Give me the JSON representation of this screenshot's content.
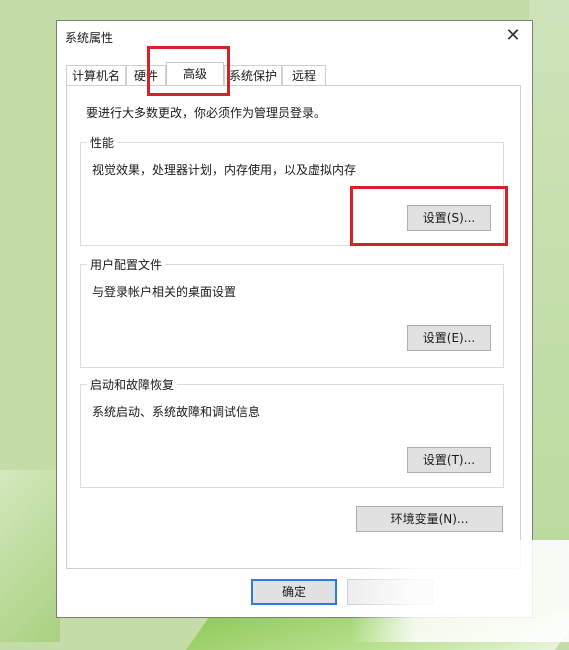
{
  "dialog": {
    "title": "系统属性",
    "close_glyph": "✕"
  },
  "tabs": [
    {
      "label": "计算机名"
    },
    {
      "label": "硬件"
    },
    {
      "label": "高级"
    },
    {
      "label": "系统保护"
    },
    {
      "label": "远程"
    }
  ],
  "active_tab": "高级",
  "advanced": {
    "admin_note": "要进行大多数更改，你必须作为管理员登录。",
    "performance": {
      "title": "性能",
      "desc": "视觉效果，处理器计划，内存使用，以及虚拟内存",
      "button": "设置(S)..."
    },
    "profiles": {
      "title": "用户配置文件",
      "desc": "与登录帐户相关的桌面设置",
      "button": "设置(E)..."
    },
    "startup": {
      "title": "启动和故障恢复",
      "desc": "系统启动、系统故障和调试信息",
      "button": "设置(T)..."
    },
    "env_button": "环境变量(N)..."
  },
  "footer": {
    "ok_label": "确定"
  },
  "colors": {
    "highlight": "#d8202a",
    "focus_border": "#2c7bd6",
    "background": "#c3dca8"
  },
  "icons": {
    "close": "close-icon"
  }
}
